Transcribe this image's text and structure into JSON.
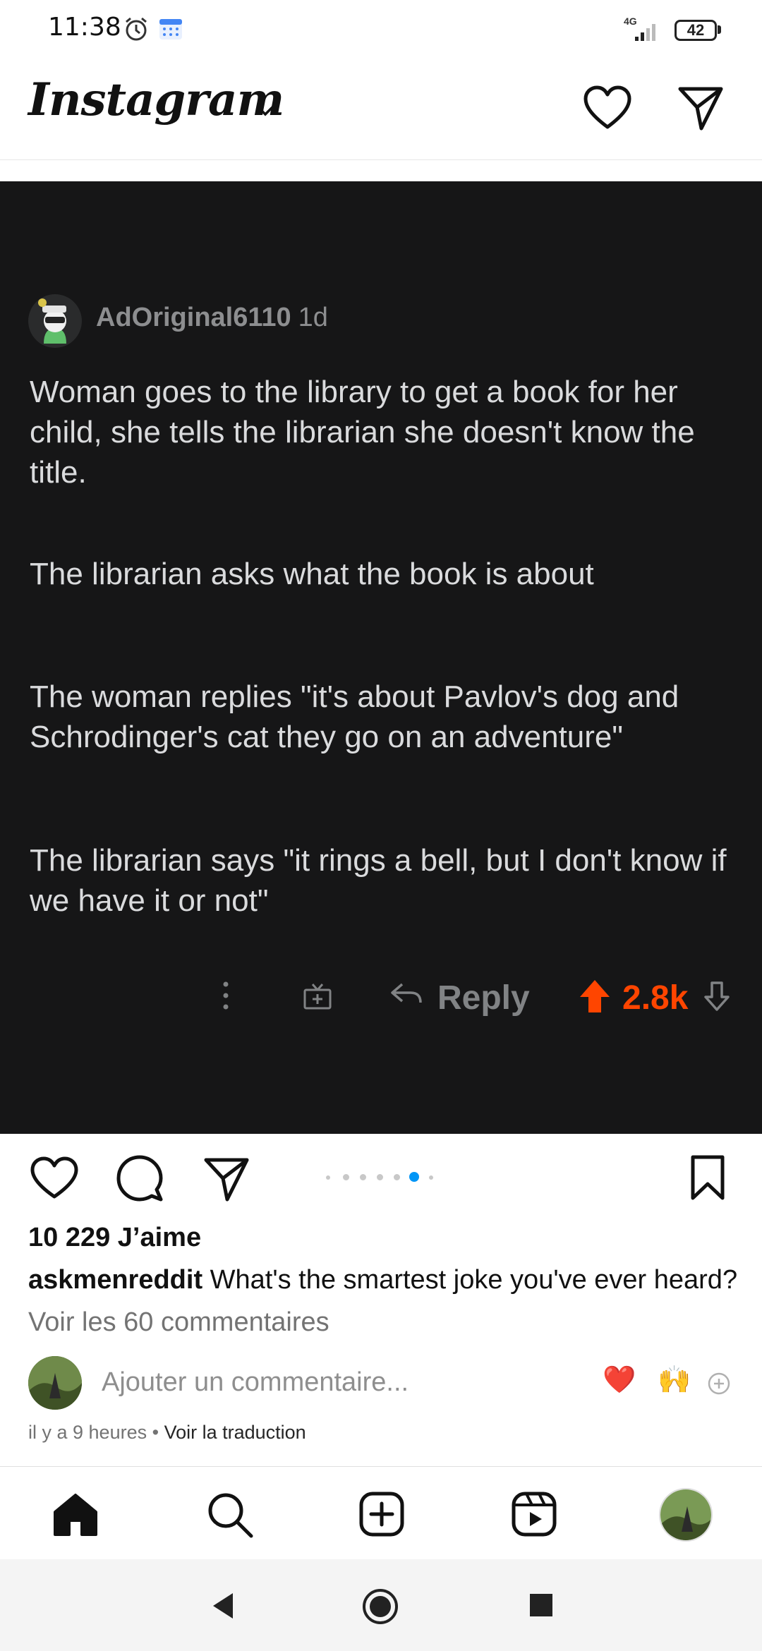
{
  "status_bar": {
    "time": "11:38",
    "network": "4G",
    "battery": "42",
    "icons": [
      "alarm-icon",
      "calendar-icon",
      "signal-icon",
      "battery-icon"
    ]
  },
  "header": {
    "logo": "Instagram",
    "icons": [
      "chevron-down-icon",
      "heart-icon",
      "direct-message-icon"
    ]
  },
  "post_image": {
    "background": "#161617",
    "author": "AdOriginal6110",
    "age": "1d",
    "paragraphs": [
      "Woman goes to the library to get a book for her child, she tells the librarian she doesn't know the title.",
      "The librarian asks what the book is about",
      "The woman replies \"it's about Pavlov's dog and Schrodinger's cat they go on an adventure\"",
      "The librarian says \"it rings a bell, but I don't know if we have it or not\""
    ],
    "reply_label": "Reply",
    "score": "2.8k",
    "upvote_color": "#ff4500",
    "icons": [
      "more-options-icon",
      "award-icon",
      "reply-arrow-icon",
      "upvote-icon",
      "downvote-icon"
    ]
  },
  "post_actions": {
    "carousel_total": 7,
    "carousel_active_index": 5,
    "accent": "#0095f6",
    "icons": [
      "like-icon",
      "comment-icon",
      "share-icon",
      "save-icon"
    ]
  },
  "likes": "10 229 J’aime",
  "caption": {
    "user": "askmenreddit",
    "text": "What's the smartest joke you've ever heard?"
  },
  "view_comments": "Voir les 60 commentaires",
  "comment_box": {
    "placeholder": "Ajouter un commentaire...",
    "quick_emojis": [
      "❤️",
      "🙌"
    ]
  },
  "timestamp": "il y a 9 heures",
  "separator": "•",
  "translate_link": "Voir la traduction",
  "bottom_nav": [
    "home-icon",
    "search-icon",
    "create-icon",
    "reels-icon",
    "profile-avatar"
  ],
  "system_nav": [
    "back-icon",
    "home-circle-icon",
    "recents-icon"
  ]
}
